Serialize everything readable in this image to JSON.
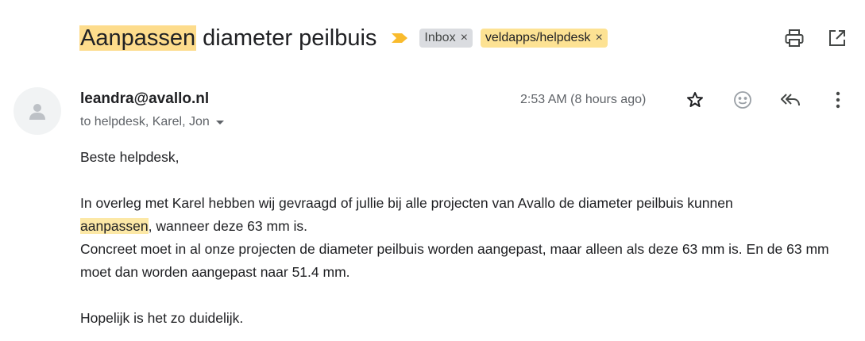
{
  "subject": {
    "highlight": "Aanpassen",
    "rest": " diameter peilbuis"
  },
  "labels": [
    {
      "name": "Inbox",
      "remove": "×"
    },
    {
      "name": "veldapps/helpdesk",
      "remove": "×"
    }
  ],
  "toolbar": {
    "print_icon": "print-icon",
    "popout_icon": "open-in-new-window-icon"
  },
  "message": {
    "sender": "leandra@avallo.nl",
    "recipients": "to helpdesk, Karel, Jon",
    "timestamp": "2:53 AM (8 hours ago)",
    "icons": [
      "star-icon",
      "emoji-reaction-icon",
      "reply-all-icon",
      "more-vertical-icon"
    ]
  },
  "body": {
    "greeting": "Beste helpdesk,",
    "p1_a": "In overleg met Karel hebben wij gevraagd of jullie bij alle projecten van Avallo de diameter peilbuis kunnen",
    "p1_highlight": "aanpassen",
    "p1_b": ", wanneer deze 63 mm is.",
    "p2": "Concreet moet in al onze projecten de diameter peilbuis worden aangepast, maar alleen als deze 63 mm is. En de 63 mm moet dan worden aangepast naar 51.4 mm.",
    "closing": "Hopelijk is het zo duidelijk."
  },
  "colors": {
    "highlight": "#fce8a6",
    "importance": "#f9bb2d",
    "inbox_chip": "#dadce0",
    "label_chip": "#fde293"
  }
}
